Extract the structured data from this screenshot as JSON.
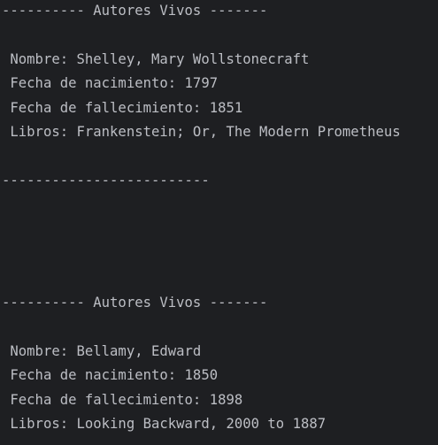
{
  "console": {
    "blocks": [
      {
        "header": "---------- Autores Vivos -------",
        "name_line": " Nombre: Shelley, Mary Wollstonecraft",
        "birth_line": " Fecha de nacimiento: 1797",
        "death_line": " Fecha de fallecimiento: 1851",
        "books_line": " Libros: Frankenstein; Or, The Modern Prometheus",
        "footer": "-------------------------"
      },
      {
        "header": "---------- Autores Vivos -------",
        "name_line": " Nombre: Bellamy, Edward",
        "birth_line": " Fecha de nacimiento: 1850",
        "death_line": " Fecha de fallecimiento: 1898",
        "books_line": " Libros: Looking Backward, 2000 to 1887"
      }
    ]
  }
}
